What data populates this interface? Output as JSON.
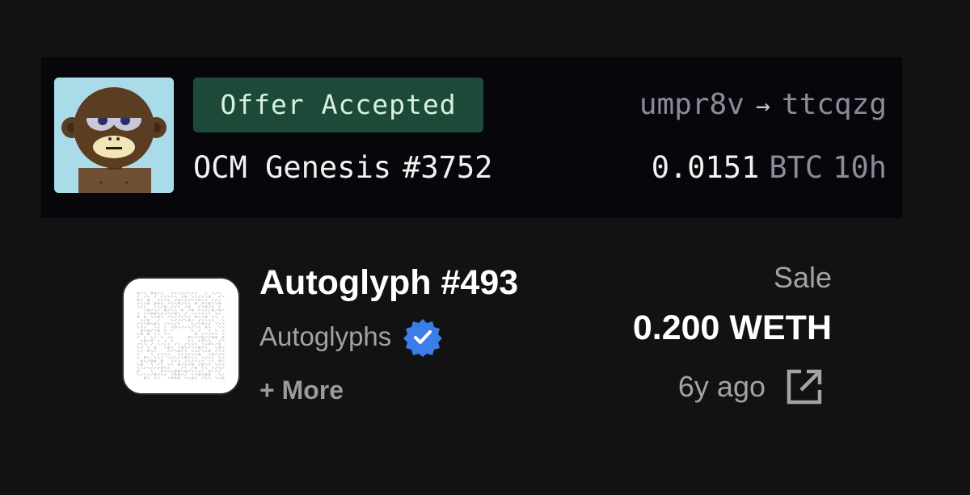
{
  "offer_card": {
    "status": "Offer Accepted",
    "from": "umpr8v",
    "arrow": "→",
    "to": "ttcqzg",
    "collection": "OCM Genesis",
    "token": "#3752",
    "amount": "0.0151",
    "currency": "BTC",
    "age": "10h",
    "colors": {
      "badge_bg": "#1d4a38",
      "card_bg": "#07060a"
    }
  },
  "sale_card": {
    "title": "Autoglyph #493",
    "collection": "Autoglyphs",
    "more_label": "+ More",
    "event_type": "Sale",
    "price": "0.200 WETH",
    "time_ago": "6y ago",
    "icons": {
      "verified": "verified-badge-icon",
      "external": "external-link-icon"
    },
    "colors": {
      "verified": "#3b7de9"
    }
  }
}
